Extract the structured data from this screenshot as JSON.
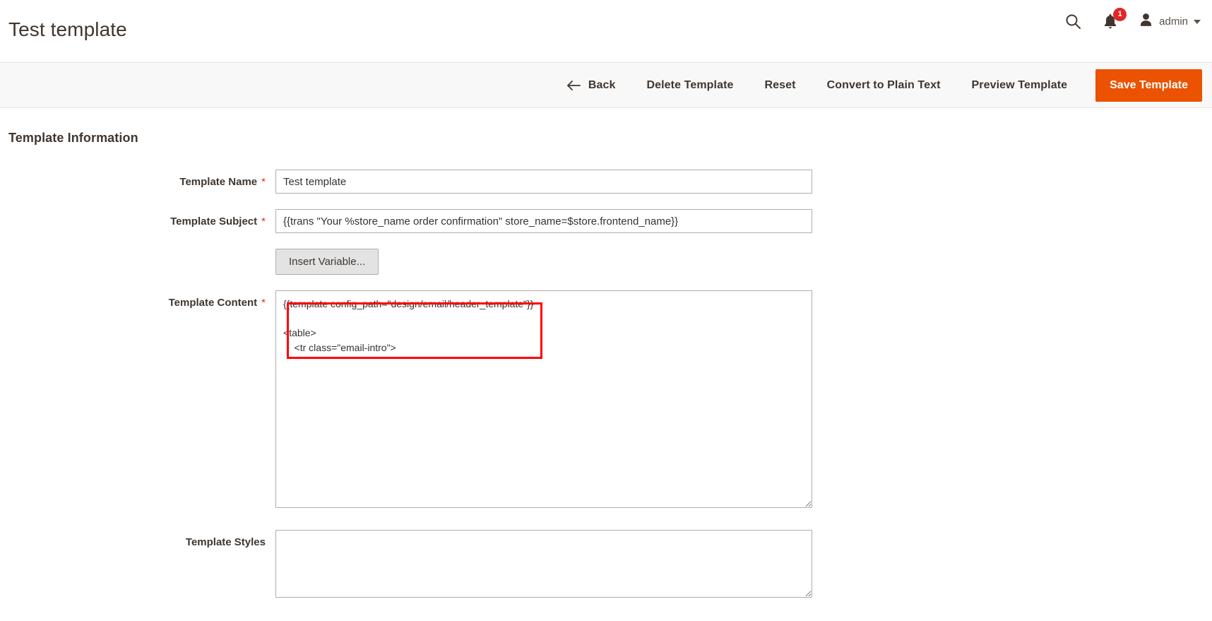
{
  "header": {
    "title": "Test template",
    "search_icon": "search-icon",
    "notifications_icon": "bell-icon",
    "notifications_count": "1",
    "user_icon": "user-avatar-icon",
    "user_name": "admin",
    "caret_icon": "chevron-down-icon"
  },
  "toolbar": {
    "back_icon": "arrow-left-icon",
    "back_label": "Back",
    "delete_label": "Delete Template",
    "reset_label": "Reset",
    "convert_label": "Convert to Plain Text",
    "preview_label": "Preview Template",
    "save_label": "Save Template",
    "save_color": "#eb5202"
  },
  "section": {
    "title": "Template Information"
  },
  "fields": {
    "template_name": {
      "label": "Template Name",
      "required": "*",
      "value": "Test template",
      "placeholder": ""
    },
    "template_subject": {
      "label": "Template Subject",
      "required": "*",
      "value": "{{trans \"Your %store_name order confirmation\" store_name=$store.frontend_name}}",
      "placeholder": ""
    },
    "insert_variable": {
      "label": "Insert Variable..."
    },
    "template_content": {
      "label": "Template Content",
      "required": "*",
      "value": "{{template config_path=\"design/email/header_template\"}}\n\n<table>\n    <tr class=\"email-intro\">",
      "placeholder": ""
    },
    "template_styles": {
      "label": "Template Styles",
      "required": "",
      "value": "",
      "placeholder": ""
    }
  },
  "annotation": {
    "highlight_color": "#ff0000"
  }
}
